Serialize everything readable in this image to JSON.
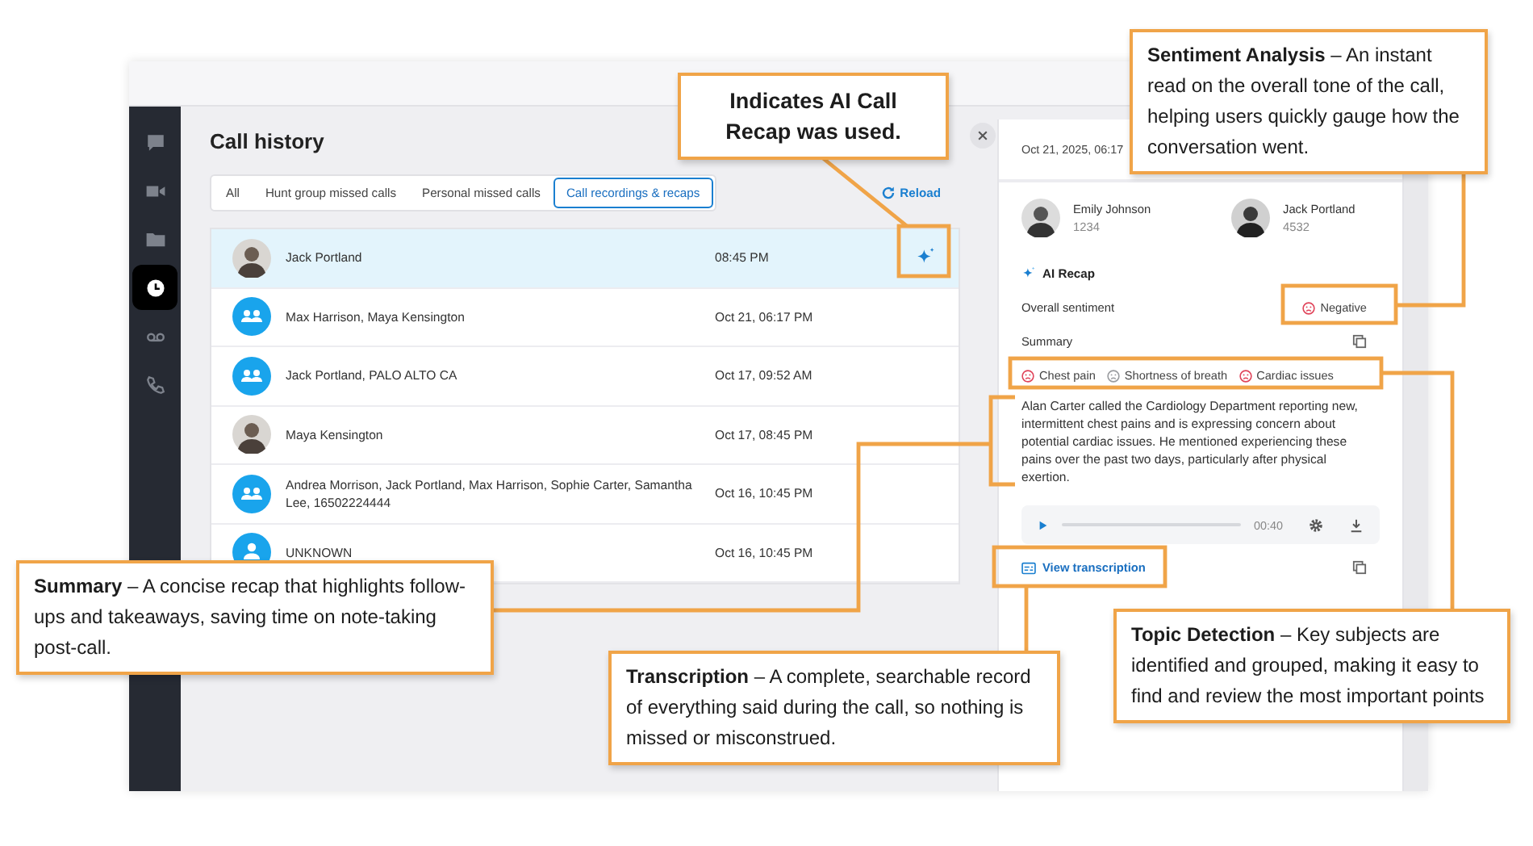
{
  "sidebar": {
    "items": [
      {
        "kind": "chat",
        "selected": false
      },
      {
        "kind": "video",
        "selected": false
      },
      {
        "kind": "folder",
        "selected": false
      },
      {
        "kind": "clock",
        "selected": true
      },
      {
        "kind": "voicemail",
        "selected": false
      },
      {
        "kind": "phone",
        "selected": false
      }
    ]
  },
  "call_history": {
    "title": "Call history",
    "tabs": [
      {
        "label": "All",
        "selected": false
      },
      {
        "label": "Hunt group missed calls",
        "selected": false
      },
      {
        "label": "Personal missed calls",
        "selected": false
      },
      {
        "label": "Call recordings & recaps",
        "selected": true
      }
    ],
    "reload": "Reload",
    "calls": [
      {
        "kind": "photo",
        "name": "Jack Portland",
        "time": "08:45 PM",
        "ai_recap": true,
        "selected": true
      },
      {
        "kind": "group",
        "name": "Max Harrison, Maya Kensington",
        "time": "Oct 21, 06:17 PM",
        "ai_recap": false,
        "selected": false
      },
      {
        "kind": "group",
        "name": "Jack Portland, PALO ALTO CA",
        "time": "Oct 17, 09:52 AM",
        "ai_recap": false,
        "selected": false
      },
      {
        "kind": "photo",
        "name": "Maya Kensington",
        "time": "Oct 17, 08:45 PM",
        "ai_recap": false,
        "selected": false
      },
      {
        "kind": "group",
        "name": "Andrea Morrison, Jack Portland, Max Harrison, Sophie Carter, Samantha Lee, 16502224444",
        "time": "Oct 16, 10:45 PM",
        "ai_recap": false,
        "selected": false
      },
      {
        "kind": "person",
        "name": "UNKNOWN",
        "time": "Oct 16, 10:45 PM",
        "ai_recap": false,
        "selected": false
      }
    ]
  },
  "detail": {
    "date": "Oct 21, 2025, 06:17",
    "caller": {
      "name": "Emily Johnson",
      "number": "1234"
    },
    "callee": {
      "name": "Jack Portland",
      "number": "4532"
    },
    "ai_recap_label": "AI Recap",
    "sentiment_label": "Overall sentiment",
    "sentiment": {
      "label": "Negative",
      "color": "#e0445a"
    },
    "summary_label": "Summary",
    "topics": [
      {
        "label": "Chest pain",
        "color": "#e0445a"
      },
      {
        "label": "Shortness of breath",
        "color": "#9a9ca0"
      },
      {
        "label": "Cardiac issues",
        "color": "#e0445a"
      }
    ],
    "summary_text": "Alan Carter called the Cardiology Department reporting new, intermittent chest pains and is expressing concern about potential cardiac issues. He mentioned experiencing these pains over the past two days, particularly after physical exertion.",
    "player": {
      "time": "00:40"
    },
    "view_transcription": "View transcription"
  },
  "callouts": [
    {
      "text": "Indicates AI Call Recap was used.",
      "bold": true
    },
    {
      "text": "**Sentiment Analysis** – An instant read on the overall tone of the call, helping users quickly gauge how the conversation went.",
      "bold": false
    },
    {
      "text": "**Summary** – A concise recap that highlights follow-ups and takeaways, saving time on note-taking post-call.",
      "bold": false
    },
    {
      "text": "**Transcription** – A complete, searchable record of everything said during the call, so nothing is missed or misconstrued.",
      "bold": false
    },
    {
      "text": "**Topic Detection** – Key subjects are identified and grouped, making it easy to find and review the most important points",
      "bold": false
    }
  ]
}
